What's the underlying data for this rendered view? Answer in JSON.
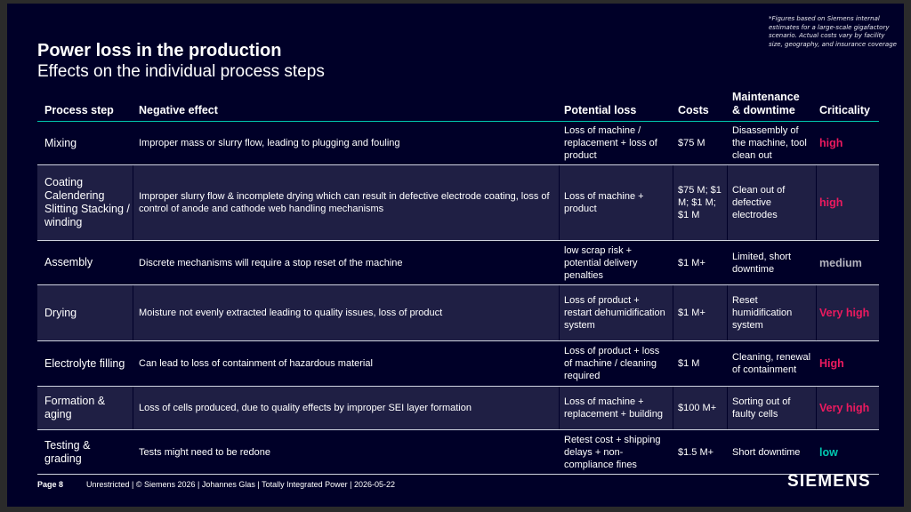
{
  "note": "*Figures based on Siemens internal estimates for a large-scale gigafactory scenario. Actual costs vary by facility size, geography, and insurance coverage",
  "title": "Power loss in the production",
  "subtitle": "Effects on the individual process steps",
  "headers": {
    "process_step": "Process step",
    "negative_effect": "Negative effect",
    "potential_loss": "Potential loss",
    "costs": "Costs",
    "maintenance": "Maintenance & downtime",
    "criticality": "Criticality"
  },
  "colors": {
    "high": "#ec1a5f",
    "medium": "#b3b3be",
    "low": "#00c7b0",
    "accent": "#00c7b0",
    "background": "#000028"
  },
  "rows": [
    {
      "step": "Mixing",
      "effect": "Improper mass or slurry flow, leading to plugging and fouling",
      "loss": "Loss of machine / replacement + loss of product",
      "costs": "$75 M",
      "maintenance": "Disassembly of the machine, tool clean out",
      "criticality": "high",
      "level": "high"
    },
    {
      "step": "Coating Calendering Slitting Stacking / winding",
      "effect": "Improper slurry flow & incomplete drying which can result in defective electrode coating, loss of control of anode and cathode web handling mechanisms",
      "loss": "Loss of machine + product",
      "costs": "$75 M; $1 M; $1 M; $1 M",
      "maintenance": "Clean out of defective electrodes",
      "criticality": "high",
      "level": "high"
    },
    {
      "step": "Assembly",
      "effect": "Discrete mechanisms will require a stop reset of the machine",
      "loss": "low scrap risk + potential delivery penalties",
      "costs": "$1 M+",
      "maintenance": "Limited, short downtime",
      "criticality": "medium",
      "level": "medium"
    },
    {
      "step": "Drying",
      "effect": "Moisture not evenly extracted leading to quality issues, loss of product",
      "loss": "Loss of product + restart dehumidification system",
      "costs": "$1 M+",
      "maintenance": "Reset humidification system",
      "criticality": "Very high",
      "level": "high"
    },
    {
      "step": "Electrolyte filling",
      "effect": "Can lead to loss of containment of hazardous material",
      "loss": "Loss of product + loss of machine / cleaning required",
      "costs": "$1 M",
      "maintenance": "Cleaning, renewal of containment",
      "criticality": "High",
      "level": "high"
    },
    {
      "step": "Formation & aging",
      "effect": "Loss of cells produced, due to quality effects by improper SEI layer formation",
      "loss": "Loss of machine + replacement + building",
      "costs": "$100 M+",
      "maintenance": "Sorting out of faulty cells",
      "criticality": "Very high",
      "level": "high"
    },
    {
      "step": "Testing & grading",
      "effect": "Tests might need to be redone",
      "loss": "Retest cost + shipping delays + non-compliance fines",
      "costs": "$1.5 M+",
      "maintenance": "Short downtime",
      "criticality": "low",
      "level": "low"
    }
  ],
  "footer": {
    "page": "Page 8",
    "text": "Unrestricted | © Siemens 2026 | Johannes Glas | Totally Integrated Power | 2026-05-22"
  },
  "logo": "SIEMENS"
}
